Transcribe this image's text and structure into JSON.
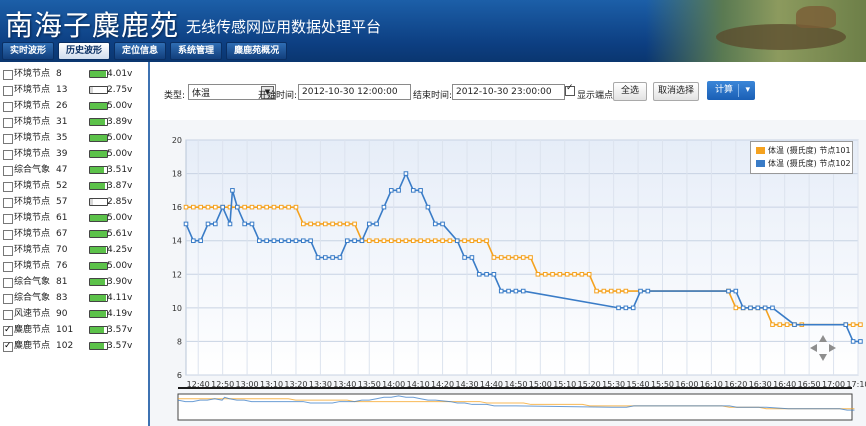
{
  "header": {
    "brand": "南海子麋鹿苑",
    "subtitle": "无线传感网应用数据处理平台"
  },
  "tabs": [
    {
      "label": "实时波形"
    },
    {
      "label": "历史波形"
    },
    {
      "label": "定位信息"
    },
    {
      "label": "系统管理"
    },
    {
      "label": "麋鹿苑概况"
    }
  ],
  "sidebar": {
    "nodes": [
      {
        "label": "环境节点",
        "num": "8",
        "voltage": "4.01v",
        "level": 0.95,
        "checked": false
      },
      {
        "label": "环境节点",
        "num": "13",
        "voltage": "2.75v",
        "level": 0.2,
        "checked": false
      },
      {
        "label": "环境节点",
        "num": "26",
        "voltage": "5.00v",
        "level": 1.0,
        "checked": false
      },
      {
        "label": "环境节点",
        "num": "31",
        "voltage": "3.89v",
        "level": 0.9,
        "checked": false
      },
      {
        "label": "环境节点",
        "num": "35",
        "voltage": "5.00v",
        "level": 1.0,
        "checked": false
      },
      {
        "label": "环境节点",
        "num": "39",
        "voltage": "5.00v",
        "level": 1.0,
        "checked": false
      },
      {
        "label": "综合气象",
        "num": "47",
        "voltage": "3.51v",
        "level": 0.85,
        "checked": false
      },
      {
        "label": "环境节点",
        "num": "52",
        "voltage": "3.87v",
        "level": 0.9,
        "checked": false
      },
      {
        "label": "环境节点",
        "num": "57",
        "voltage": "2.85v",
        "level": 0.2,
        "checked": false
      },
      {
        "label": "环境节点",
        "num": "61",
        "voltage": "5.00v",
        "level": 1.0,
        "checked": false
      },
      {
        "label": "环境节点",
        "num": "67",
        "voltage": "5.61v",
        "level": 1.0,
        "checked": false
      },
      {
        "label": "环境节点",
        "num": "70",
        "voltage": "4.25v",
        "level": 0.95,
        "checked": false
      },
      {
        "label": "环境节点",
        "num": "76",
        "voltage": "5.00v",
        "level": 1.0,
        "checked": false
      },
      {
        "label": "综合气象",
        "num": "81",
        "voltage": "3.90v",
        "level": 0.9,
        "checked": false
      },
      {
        "label": "综合气象",
        "num": "83",
        "voltage": "4.11v",
        "level": 0.95,
        "checked": false
      },
      {
        "label": "风速节点",
        "num": "90",
        "voltage": "4.19v",
        "level": 0.95,
        "checked": false
      },
      {
        "label": "麋鹿节点",
        "num": "101",
        "voltage": "3.57v",
        "level": 0.85,
        "checked": true
      },
      {
        "label": "麋鹿节点",
        "num": "102",
        "voltage": "3.57v",
        "level": 0.85,
        "checked": true
      }
    ]
  },
  "toolbar": {
    "type_label": "类型:",
    "type_value": "体温",
    "start_label": "开始时间:",
    "start_value": "2012-10-30 12:00:00",
    "end_label": "结束时间:",
    "end_value": "2012-10-30 23:00:00",
    "show_points_label": "显示端点",
    "show_points_checked": true,
    "select_all": "全选",
    "deselect": "取消选择",
    "compute": "计算"
  },
  "colors": {
    "series1": "#f5a21f",
    "series2": "#3a7cc7",
    "battery_good": "#5cc24a",
    "battery_low": "#d8d8d8"
  },
  "chart_data": {
    "type": "line",
    "ylim": [
      6,
      20
    ],
    "yticks": [
      6,
      8,
      10,
      12,
      14,
      16,
      18,
      20
    ],
    "x_range_min": [
      755,
      1030
    ],
    "xticks": [
      "12:40",
      "12:50",
      "13:00",
      "13:10",
      "13:20",
      "13:30",
      "13:40",
      "13:50",
      "14:00",
      "14:10",
      "14:20",
      "14:30",
      "14:40",
      "14:50",
      "15:00",
      "15:10",
      "15:20",
      "15:30",
      "15:40",
      "15:50",
      "16:00",
      "16:10",
      "16:20",
      "16:30",
      "16:40",
      "16:50",
      "17:00",
      "17:10"
    ],
    "xtick_min": [
      760,
      770,
      780,
      790,
      800,
      810,
      820,
      830,
      840,
      850,
      860,
      870,
      880,
      890,
      900,
      910,
      920,
      930,
      940,
      950,
      960,
      970,
      980,
      990,
      1000,
      1010,
      1020,
      1030
    ],
    "series": [
      {
        "name": "体温 (摄氏度) 节点101",
        "points": [
          [
            755,
            16
          ],
          [
            758,
            16
          ],
          [
            761,
            16
          ],
          [
            764,
            16
          ],
          [
            767,
            16
          ],
          [
            770,
            16
          ],
          [
            773,
            16
          ],
          [
            776,
            16
          ],
          [
            779,
            16
          ],
          [
            782,
            16
          ],
          [
            785,
            16
          ],
          [
            788,
            16
          ],
          [
            791,
            16
          ],
          [
            794,
            16
          ],
          [
            797,
            16
          ],
          [
            800,
            16
          ],
          [
            803,
            15
          ],
          [
            806,
            15
          ],
          [
            809,
            15
          ],
          [
            812,
            15
          ],
          [
            815,
            15
          ],
          [
            818,
            15
          ],
          [
            821,
            15
          ],
          [
            824,
            15
          ],
          [
            827,
            14
          ],
          [
            830,
            14
          ],
          [
            833,
            14
          ],
          [
            836,
            14
          ],
          [
            839,
            14
          ],
          [
            842,
            14
          ],
          [
            845,
            14
          ],
          [
            848,
            14
          ],
          [
            851,
            14
          ],
          [
            854,
            14
          ],
          [
            857,
            14
          ],
          [
            860,
            14
          ],
          [
            863,
            14
          ],
          [
            866,
            14
          ],
          [
            869,
            14
          ],
          [
            872,
            14
          ],
          [
            875,
            14
          ],
          [
            878,
            14
          ],
          [
            881,
            13
          ],
          [
            884,
            13
          ],
          [
            887,
            13
          ],
          [
            890,
            13
          ],
          [
            893,
            13
          ],
          [
            896,
            13
          ],
          [
            899,
            12
          ],
          [
            902,
            12
          ],
          [
            905,
            12
          ],
          [
            908,
            12
          ],
          [
            911,
            12
          ],
          [
            914,
            12
          ],
          [
            917,
            12
          ],
          [
            920,
            12
          ],
          [
            923,
            11
          ],
          [
            926,
            11
          ],
          [
            929,
            11
          ],
          [
            932,
            11
          ],
          [
            935,
            11
          ],
          [
            977,
            11
          ],
          [
            980,
            10
          ],
          [
            983,
            10
          ],
          [
            986,
            10
          ],
          [
            989,
            10
          ],
          [
            992,
            10
          ],
          [
            995,
            9
          ],
          [
            998,
            9
          ],
          [
            1001,
            9
          ],
          [
            1004,
            9
          ],
          [
            1007,
            9
          ],
          [
            1025,
            9
          ],
          [
            1028,
            9
          ],
          [
            1031,
            9
          ]
        ]
      },
      {
        "name": "体温 (摄氏度) 节点102",
        "points": [
          [
            755,
            15
          ],
          [
            758,
            14
          ],
          [
            761,
            14
          ],
          [
            764,
            15
          ],
          [
            767,
            15
          ],
          [
            770,
            16
          ],
          [
            773,
            15
          ],
          [
            774,
            17
          ],
          [
            776,
            16
          ],
          [
            779,
            15
          ],
          [
            782,
            15
          ],
          [
            785,
            14
          ],
          [
            788,
            14
          ],
          [
            791,
            14
          ],
          [
            794,
            14
          ],
          [
            797,
            14
          ],
          [
            800,
            14
          ],
          [
            803,
            14
          ],
          [
            806,
            14
          ],
          [
            809,
            13
          ],
          [
            812,
            13
          ],
          [
            815,
            13
          ],
          [
            818,
            13
          ],
          [
            821,
            14
          ],
          [
            824,
            14
          ],
          [
            827,
            14
          ],
          [
            830,
            15
          ],
          [
            833,
            15
          ],
          [
            836,
            16
          ],
          [
            839,
            17
          ],
          [
            842,
            17
          ],
          [
            845,
            18
          ],
          [
            848,
            17
          ],
          [
            851,
            17
          ],
          [
            854,
            16
          ],
          [
            857,
            15
          ],
          [
            860,
            15
          ],
          [
            866,
            14
          ],
          [
            869,
            13
          ],
          [
            872,
            13
          ],
          [
            875,
            12
          ],
          [
            878,
            12
          ],
          [
            881,
            12
          ],
          [
            884,
            11
          ],
          [
            887,
            11
          ],
          [
            890,
            11
          ],
          [
            893,
            11
          ],
          [
            932,
            10
          ],
          [
            935,
            10
          ],
          [
            938,
            10
          ],
          [
            941,
            11
          ],
          [
            944,
            11
          ],
          [
            977,
            11
          ],
          [
            980,
            11
          ],
          [
            983,
            10
          ],
          [
            986,
            10
          ],
          [
            989,
            10
          ],
          [
            992,
            10
          ],
          [
            995,
            10
          ],
          [
            1004,
            9
          ],
          [
            1025,
            9
          ],
          [
            1028,
            8
          ],
          [
            1031,
            8
          ]
        ]
      }
    ]
  }
}
